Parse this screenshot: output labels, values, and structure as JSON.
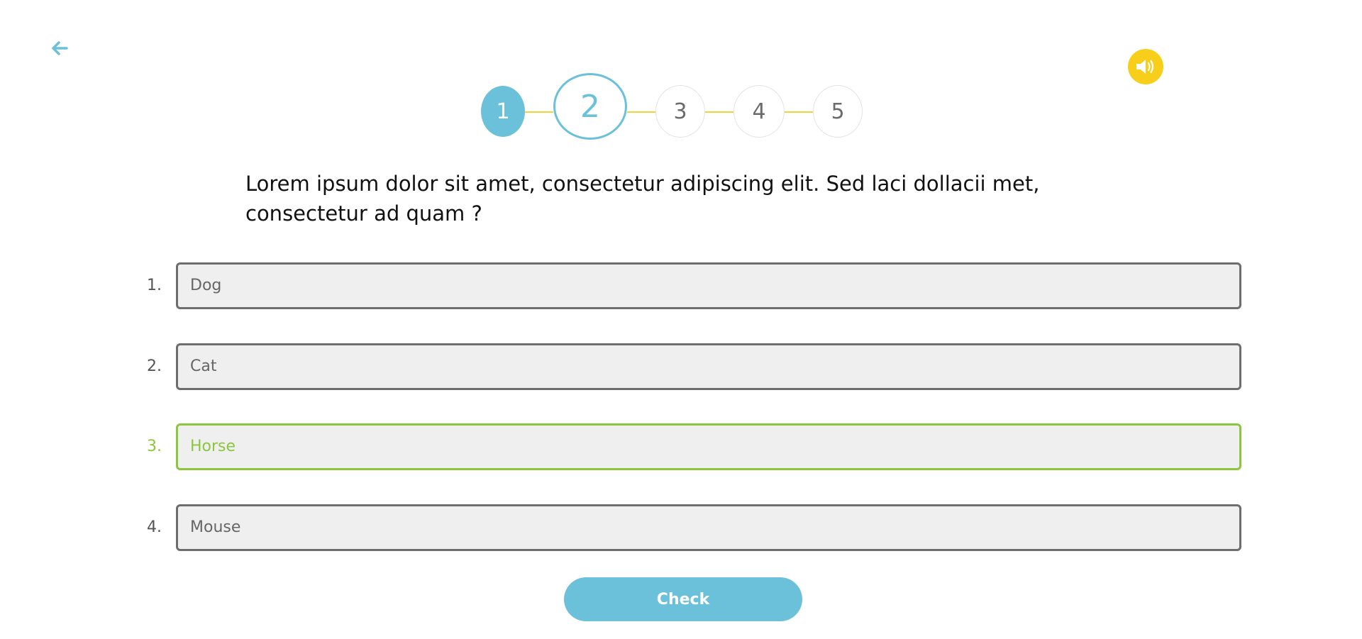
{
  "nav": {
    "back_icon": "arrow-left-icon",
    "sound_icon": "speaker-icon"
  },
  "stepper": {
    "current": 2,
    "steps": [
      "1",
      "2",
      "3",
      "4",
      "5"
    ]
  },
  "question": {
    "text": "Lorem ipsum dolor sit amet, consectetur adipiscing elit. Sed laci dollacii met, consectetur ad quam ?"
  },
  "options": [
    {
      "number": "1.",
      "label": "Dog"
    },
    {
      "number": "2.",
      "label": "Cat"
    },
    {
      "number": "3.",
      "label": "Horse"
    },
    {
      "number": "4.",
      "label": "Mouse"
    }
  ],
  "selected_option": 3,
  "check_button": {
    "label": "Check"
  },
  "colors": {
    "accent": "#6bc1da",
    "selected": "#8cc63f",
    "sound": "#f7cf1a",
    "connector": "#f3d23d"
  }
}
